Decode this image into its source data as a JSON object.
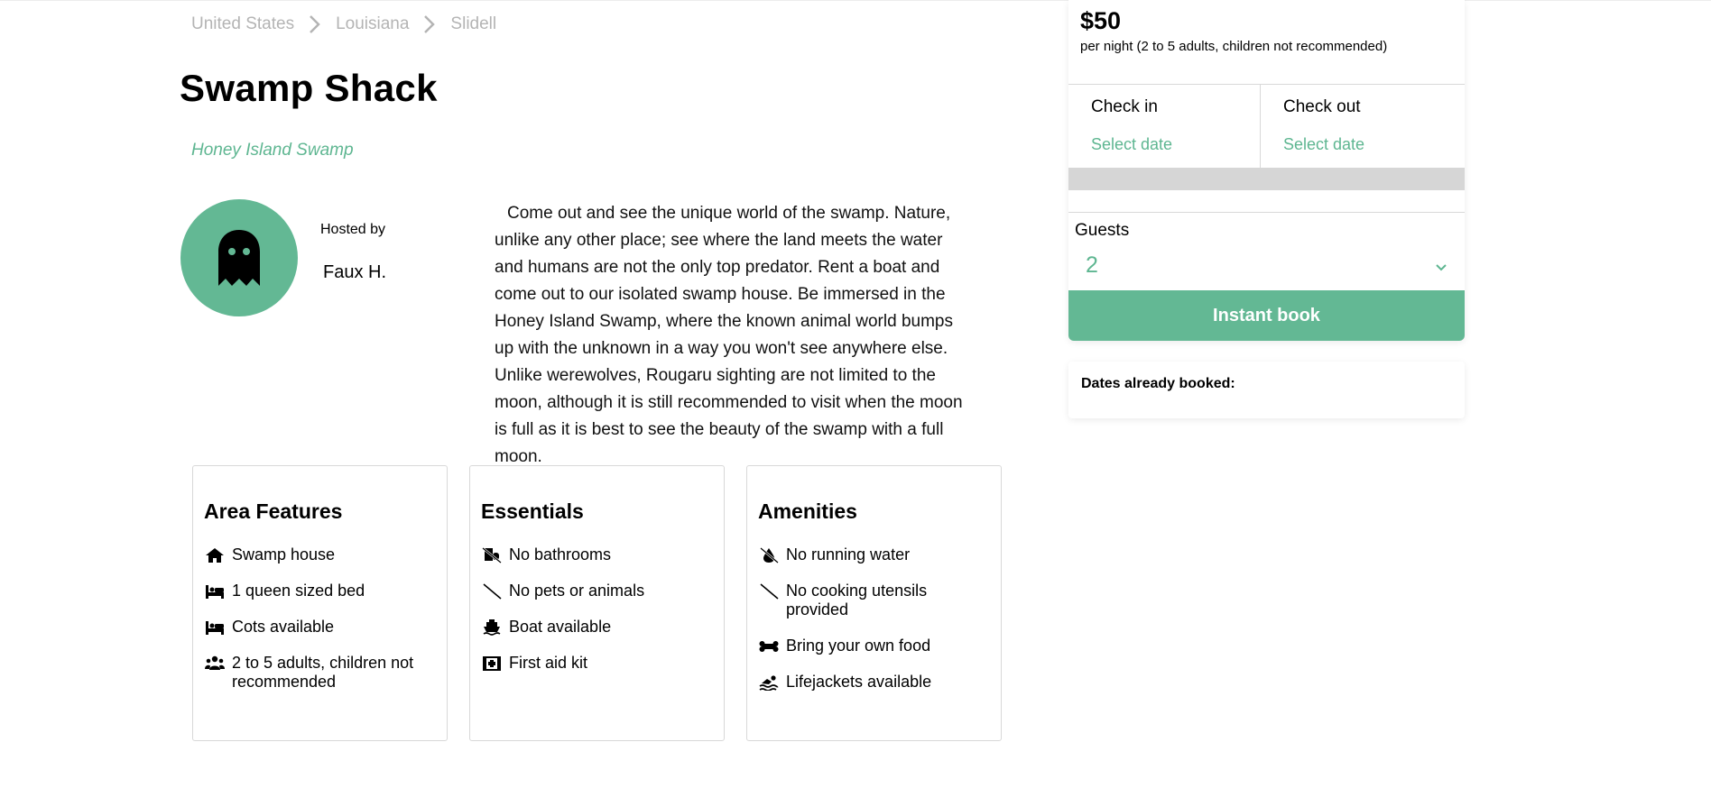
{
  "colors": {
    "accent": "#63b894",
    "accent_text": "#5eb691",
    "muted": "#b4b4b4",
    "divider": "#d9d9d9"
  },
  "breadcrumb": [
    {
      "label": "United States"
    },
    {
      "label": "Louisiana"
    },
    {
      "label": "Slidell"
    }
  ],
  "listing": {
    "title": "Swamp Shack",
    "location": "Honey Island Swamp",
    "host_label": "Hosted by",
    "host_name": "Faux H.",
    "avatar_icon": "ghost-icon",
    "description": "Come out and see the unique world of the swamp. Nature, unlike any other place; see where the land meets the water and humans are not the only top predator. Rent a boat and come out to our isolated swamp house. Be immersed in the Honey Island Swamp, where the known animal world bumps up with the unknown in a way you won't see anywhere else. Unlike werewolves, Rougaru sighting are not limited to the moon, although it is still recommended to visit when the moon is full as it is best to see the beauty of the swamp with a full moon."
  },
  "cards": [
    {
      "title": "Area Features",
      "items": [
        {
          "icon": "home-icon",
          "label": "Swamp house"
        },
        {
          "icon": "bed-icon",
          "label": "1 queen sized bed"
        },
        {
          "icon": "bed-icon",
          "label": "Cots available"
        },
        {
          "icon": "users-icon",
          "label": "2 to 5 adults, children not recommended"
        }
      ]
    },
    {
      "title": "Essentials",
      "items": [
        {
          "icon": "no-toilet-icon",
          "label": "No bathrooms"
        },
        {
          "icon": "slash-icon",
          "label": "No pets or animals"
        },
        {
          "icon": "ship-icon",
          "label": "Boat available"
        },
        {
          "icon": "first-aid-icon",
          "label": "First aid kit"
        }
      ]
    },
    {
      "title": "Amenities",
      "items": [
        {
          "icon": "no-water-icon",
          "label": "No running water"
        },
        {
          "icon": "slash-icon",
          "label": "No cooking utensils provided"
        },
        {
          "icon": "bone-icon",
          "label": "Bring your own food"
        },
        {
          "icon": "swimmer-icon",
          "label": "Lifejackets available"
        }
      ]
    }
  ],
  "booking": {
    "price": "$50",
    "per_night": "per night (2 to 5 adults, children not recommended)",
    "check_in_label": "Check in",
    "check_in_value": "Select date",
    "check_out_label": "Check out",
    "check_out_value": "Select date",
    "guests_label": "Guests",
    "guests_value": "2",
    "book_button": "Instant book",
    "booked_title": "Dates already booked:"
  }
}
